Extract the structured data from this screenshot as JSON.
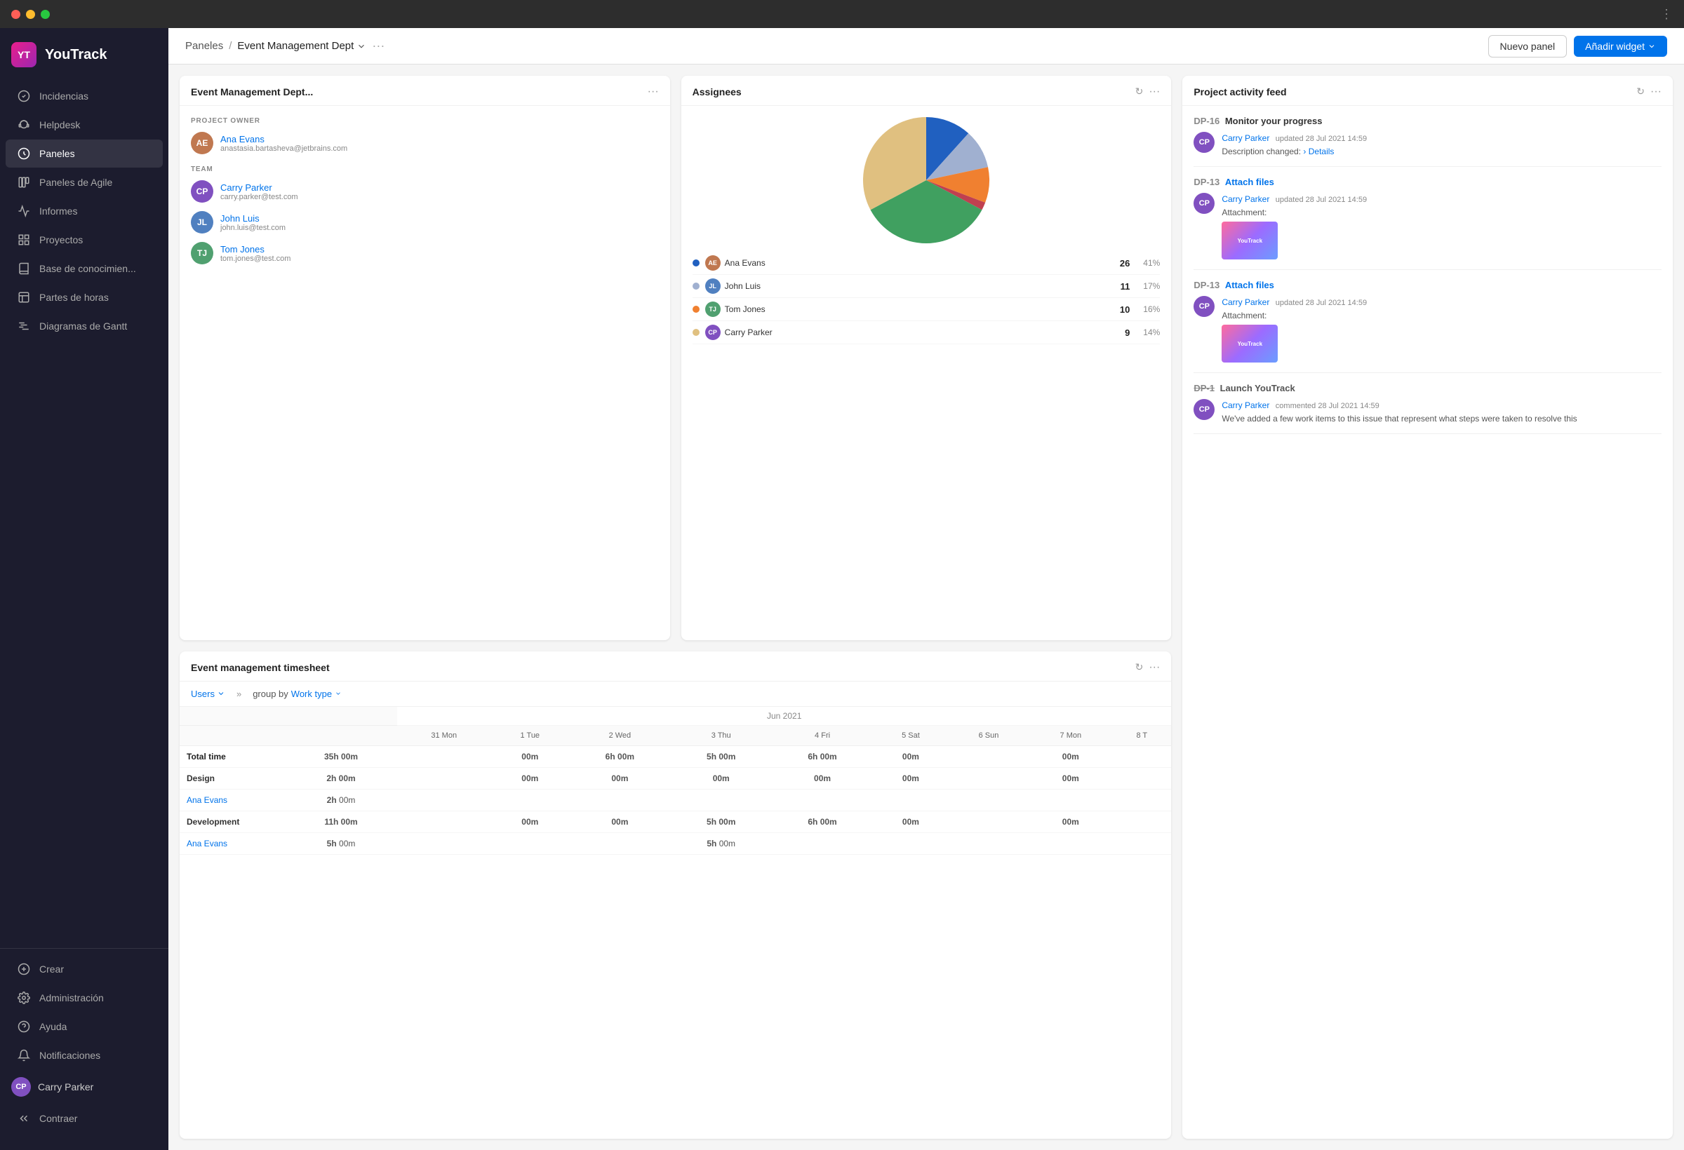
{
  "window": {
    "title": "YouTrack"
  },
  "logo": {
    "initials": "YT",
    "name": "YouTrack"
  },
  "sidebar": {
    "nav_items": [
      {
        "id": "incidencias",
        "label": "Incidencias",
        "icon": "check-circle"
      },
      {
        "id": "helpdesk",
        "label": "Helpdesk",
        "icon": "headset"
      },
      {
        "id": "paneles",
        "label": "Paneles",
        "icon": "dashboard",
        "active": true
      },
      {
        "id": "paneles-agile",
        "label": "Paneles de Agile",
        "icon": "columns"
      },
      {
        "id": "informes",
        "label": "Informes",
        "icon": "chart"
      },
      {
        "id": "proyectos",
        "label": "Proyectos",
        "icon": "grid"
      },
      {
        "id": "base-conocimiento",
        "label": "Base de conocimien...",
        "icon": "book"
      },
      {
        "id": "partes-horas",
        "label": "Partes de horas",
        "icon": "clock"
      },
      {
        "id": "diagramas-gantt",
        "label": "Diagramas de Gantt",
        "icon": "gantt"
      }
    ],
    "bottom_items": [
      {
        "id": "crear",
        "label": "Crear",
        "icon": "plus"
      },
      {
        "id": "administracion",
        "label": "Administración",
        "icon": "gear"
      },
      {
        "id": "ayuda",
        "label": "Ayuda",
        "icon": "question"
      },
      {
        "id": "notificaciones",
        "label": "Notificaciones",
        "icon": "bell"
      }
    ],
    "user": {
      "name": "Carry Parker",
      "avatar_initials": "CP"
    },
    "collapse_label": "Contraer"
  },
  "topbar": {
    "breadcrumb_parent": "Paneles",
    "breadcrumb_current": "Event Management Dept",
    "btn_nuevo": "Nuevo panel",
    "btn_widget": "Añadir widget"
  },
  "project_widget": {
    "title": "Event Management Dept...",
    "owner_label": "PROJECT OWNER",
    "owner": {
      "name": "Ana Evans",
      "email": "anastasia.bartasheva@jetbrains.com",
      "initials": "AE",
      "color": "#c07850"
    },
    "team_label": "TEAM",
    "team": [
      {
        "name": "Carry Parker",
        "email": "carry.parker@test.com",
        "initials": "CP",
        "color": "#8050c0"
      },
      {
        "name": "John Luis",
        "email": "john.luis@test.com",
        "initials": "JL",
        "color": "#5080c0"
      },
      {
        "name": "Tom Jones",
        "email": "tom.jones@test.com",
        "initials": "TJ",
        "color": "#50a070"
      }
    ]
  },
  "assignees_widget": {
    "title": "Assignees",
    "legend": [
      {
        "name": "Ana Evans",
        "color": "#2060c0",
        "count": 26,
        "pct": "41%",
        "initials": "AE",
        "bg": "#c07850"
      },
      {
        "name": "John Luis",
        "color": "#a0a0c0",
        "count": 11,
        "pct": "17%",
        "initials": "JL",
        "bg": "#5080c0"
      },
      {
        "name": "Tom Jones",
        "color": "#f08030",
        "count": 10,
        "pct": "16%",
        "initials": "TJ",
        "bg": "#50a070"
      },
      {
        "name": "Carry Parker",
        "color": "#e0c080",
        "count": 9,
        "pct": "14%",
        "initials": "CP",
        "bg": "#8050c0"
      }
    ],
    "pie": {
      "segments": [
        {
          "color": "#2060c0",
          "startAngle": 0,
          "endAngle": 147.6
        },
        {
          "color": "#a0b0d0",
          "startAngle": 147.6,
          "endAngle": 208.8
        },
        {
          "color": "#f08030",
          "startAngle": 208.8,
          "endAngle": 266.4
        },
        {
          "color": "#c04050",
          "startAngle": 266.4,
          "endAngle": 273
        },
        {
          "color": "#40a060",
          "startAngle": 273,
          "endAngle": 323.4
        },
        {
          "color": "#e0c080",
          "startAngle": 323.4,
          "endAngle": 360
        }
      ]
    }
  },
  "activity_widget": {
    "title": "Project activity feed",
    "items": [
      {
        "issue_id": "DP-16",
        "issue_title": "Monitor your progress",
        "author": "Carry Parker",
        "action": "updated",
        "time": "28 Jul 2021 14:59",
        "description": "Description changed:",
        "link_text": "› Details",
        "has_thumbnail": false
      },
      {
        "issue_id": "DP-13",
        "issue_title": "Attach files",
        "author": "Carry Parker",
        "action": "updated",
        "time": "28 Jul 2021 14:59",
        "description": "Attachment:",
        "has_thumbnail": true,
        "thumbnail_text": "YouTrack"
      },
      {
        "issue_id": "DP-13",
        "issue_title": "Attach files",
        "author": "Carry Parker",
        "action": "updated",
        "time": "28 Jul 2021 14:59",
        "description": "Attachment:",
        "has_thumbnail": true,
        "thumbnail_text": "YouTrack"
      },
      {
        "issue_id": "DP-1",
        "issue_title": "Launch YouTrack",
        "issue_strikethrough": true,
        "author": "Carry Parker",
        "action": "commented",
        "time": "28 Jul 2021 14:59",
        "description": "We've added a few work items to this issue that represent what steps were taken to resolve this",
        "has_thumbnail": false
      }
    ]
  },
  "timesheet_widget": {
    "title": "Event management timesheet",
    "users_filter": "Users",
    "group_by_label": "group by",
    "group_by_value": "Work type",
    "month_label": "Jun 2021",
    "columns": [
      "31 Mon",
      "1 Tue",
      "2 Wed",
      "3 Thu",
      "4 Fri",
      "5 Sat",
      "6 Sun",
      "7 Mon",
      "8 T"
    ],
    "rows": [
      {
        "type": "total",
        "label": "Total time",
        "time_strong": "35h",
        "time_rest": "00m",
        "values": [
          "00m",
          "6h 00m",
          "5h 00m",
          "6h 00m",
          "00m",
          "",
          "00m",
          "",
          "00"
        ]
      },
      {
        "type": "category",
        "label": "Design",
        "time_strong": "2h",
        "time_rest": "00m",
        "values": [
          "00m",
          "00m",
          "00m",
          "00m",
          "00m",
          "",
          "00m",
          "",
          ""
        ]
      },
      {
        "type": "user",
        "label": "Ana Evans",
        "time_strong": "2h",
        "time_rest": "00m",
        "values": [
          "",
          "",
          "",
          "",
          "",
          "",
          "",
          "",
          ""
        ]
      },
      {
        "type": "category",
        "label": "Development",
        "time_strong": "11h",
        "time_rest": "00m",
        "values": [
          "00m",
          "00m",
          "5h 00m",
          "6h 00m",
          "00m",
          "",
          "00m",
          "",
          ""
        ]
      },
      {
        "type": "user",
        "label": "Ana Evans",
        "time_strong": "5h",
        "time_rest": "00m",
        "values": [
          "",
          "",
          "5h 00m",
          "",
          "",
          "",
          "",
          "",
          ""
        ]
      }
    ]
  }
}
